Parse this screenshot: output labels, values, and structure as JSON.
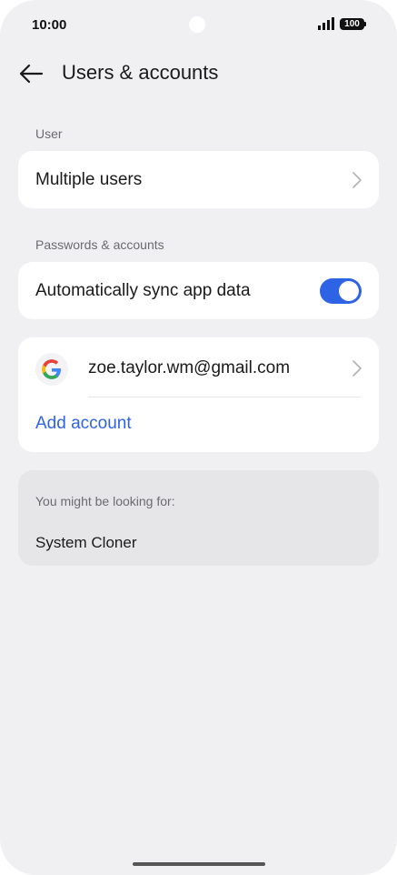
{
  "status_bar": {
    "time": "10:00",
    "battery": "100",
    "icons": [
      "signal-icon",
      "battery-icon"
    ]
  },
  "header": {
    "title": "Users & accounts",
    "back_icon": "arrow-left-icon"
  },
  "sections": {
    "user": {
      "label": "User",
      "multiple_users": "Multiple users"
    },
    "passwords_accounts": {
      "label": "Passwords & accounts",
      "sync_label": "Automatically sync app data",
      "sync_enabled": true
    }
  },
  "accounts": {
    "items": [
      {
        "email": "zoe.taylor.wm@gmail.com",
        "icon": "google-icon"
      }
    ],
    "add_account": "Add account"
  },
  "suggestions": {
    "label": "You might be looking for:",
    "items": [
      "System Cloner"
    ]
  },
  "colors": {
    "accent": "#2f63e6",
    "background": "#f0f0f3",
    "card": "#ffffff",
    "suggest_card": "#e6e6e9"
  }
}
